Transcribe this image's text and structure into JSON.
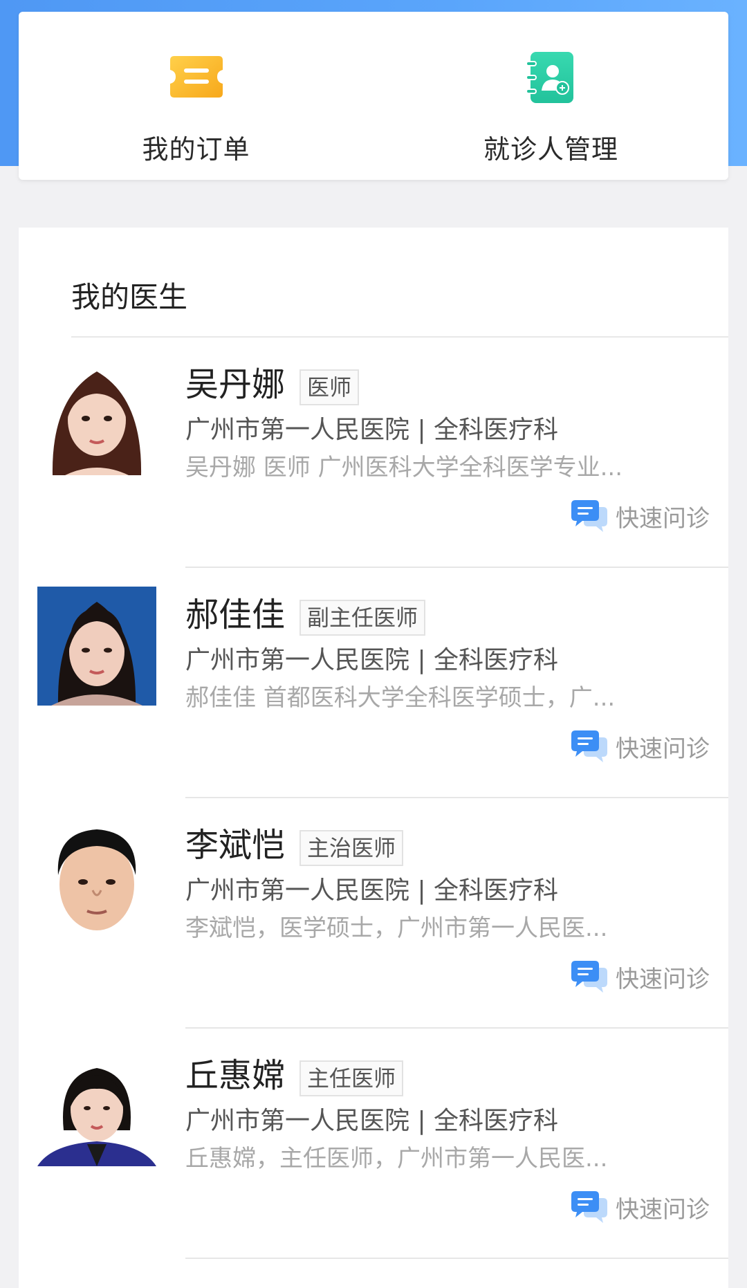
{
  "quick_actions": {
    "orders_label": "我的订单",
    "patients_label": "就诊人管理"
  },
  "doctors_section": {
    "title": "我的医生",
    "consult_label": "快速问诊",
    "doctors": [
      {
        "name": "吴丹娜",
        "title": "医师",
        "hospital": "广州市第一人民医院 | 全科医疗科",
        "intro": "吴丹娜 医师 广州医科大学全科医学专业..."
      },
      {
        "name": "郝佳佳",
        "title": "副主任医师",
        "hospital": "广州市第一人民医院 | 全科医疗科",
        "intro": "郝佳佳 首都医科大学全科医学硕士，广..."
      },
      {
        "name": "李斌恺",
        "title": "主治医师",
        "hospital": "广州市第一人民医院 | 全科医疗科",
        "intro": "李斌恺，医学硕士，广州市第一人民医..."
      },
      {
        "name": "丘惠嫦",
        "title": "主任医师",
        "hospital": "广州市第一人民医院 | 全科医疗科",
        "intro": "丘惠嫦，主任医师，广州市第一人民医..."
      }
    ]
  },
  "colors": {
    "header_blue": "#4f98f4",
    "orders_icon": "#fbb520",
    "patients_icon": "#2fd0a6",
    "consult_icon": "#3c8ef5"
  }
}
